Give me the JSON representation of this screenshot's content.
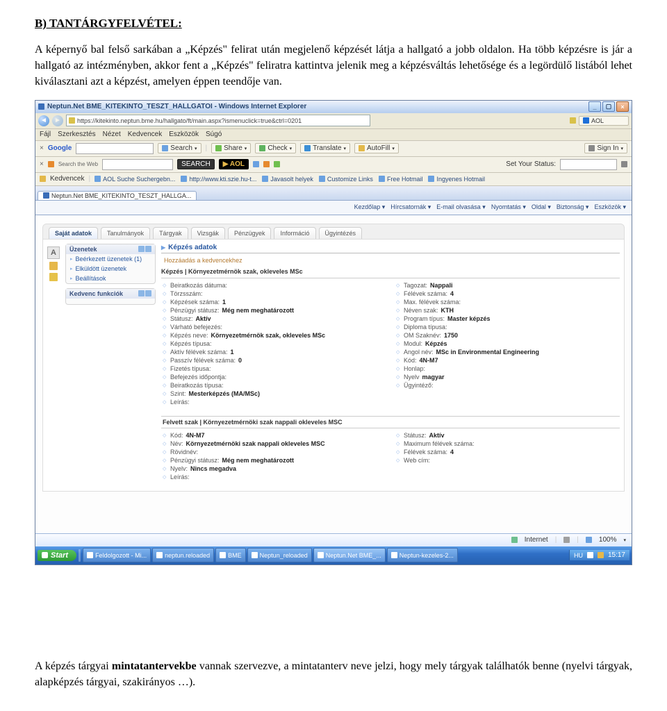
{
  "heading": "B) TANTÁRGYFELVÉTEL:",
  "intro_para": "A képernyő bal felső sarkában a „Képzés\" felirat után megjelenő képzését látja a hallgató a jobb oldalon. Ha több képzésre is jár a hallgató az intézményben, akkor fent a „Képzés\" feliratra kattintva jelenik meg a képzésváltás lehetősége és a legördülő listából lehet kiválasztani azt a képzést, amelyen éppen teendője van.",
  "para3_pre": "A képzés tárgyai ",
  "para3_bold": "mintatantervekbe",
  "para3_post": " vannak szervezve, a mintatanterv neve jelzi, hogy mely tárgyak találhatók benne (nyelvi tárgyak, alapképzés tárgyai, szakirányos …).",
  "window_title": "Neptun.Net BME_KITEKINTO_TESZT_HALLGATOI - Windows Internet Explorer",
  "url": "https://kitekinto.neptun.bme.hu/hallgato/ft/main.aspx?ismenuclick=true&ctrl=0201",
  "ie_menu": [
    "Fájl",
    "Szerkesztés",
    "Nézet",
    "Kedvencek",
    "Eszközök",
    "Súgó"
  ],
  "toolbar_google": "Google",
  "toolbar_search": "Search",
  "toolbar_share": "Share",
  "toolbar_check": "Check",
  "toolbar_translate": "Translate",
  "toolbar_autofill": "AutoFill",
  "toolbar_signin": "Sign In",
  "toolbar_aol_search": "SEARCH",
  "toolbar_set_status": "Set Your Status:",
  "fav_label": "Kedvencek",
  "fav_items": [
    "AOL Suche Suchergebn...",
    "http://www.kti.szie.hu-t...",
    "Javasolt helyek",
    "Customize Links",
    "Free Hotmail",
    "Ingyenes Hotmail"
  ],
  "tab_label": "Neptun.Net BME_KITEKINTO_TESZT_HALLGA...",
  "ie_tb2": [
    "Kezdőlap",
    "Hírcsatornák",
    "E-mail olvasása",
    "Nyomtatás",
    "Oldal",
    "Biztonság",
    "Eszközök"
  ],
  "neptun_tabs": [
    "Saját adatok",
    "Tanulmányok",
    "Tárgyak",
    "Vizsgák",
    "Pénzügyek",
    "Információ",
    "Ügyintézés"
  ],
  "sidebar_box1_title": "Üzenetek",
  "sidebar_box1_items": [
    "Beérkezett üzenetek (1)",
    "Elküldött üzenetek",
    "Beállítások"
  ],
  "sidebar_box2_title": "Kedvenc funkciók",
  "content_header": "Képzés adatok",
  "fav_link": "Hozzáadás a kedvencekhez",
  "kepzes_sub": "Képzés | Környezetmérnök szak, okleveles MSc",
  "left_fields": [
    {
      "lab": "Beiratkozás dátuma:",
      "val": ""
    },
    {
      "lab": "Törzsszám:",
      "val": ""
    },
    {
      "lab": "Képzések száma:",
      "val": "1"
    },
    {
      "lab": "Pénzügyi státusz:",
      "val": "Még nem meghatározott"
    },
    {
      "lab": "Státusz:",
      "val": "Aktív"
    },
    {
      "lab": "Várható befejezés:",
      "val": ""
    },
    {
      "lab": "Képzés neve:",
      "val": "Környezetmérnök szak, okleveles MSc"
    },
    {
      "lab": "Képzés típusa:",
      "val": ""
    },
    {
      "lab": "Aktív félévek száma:",
      "val": "1"
    },
    {
      "lab": "Passzív félévek száma:",
      "val": "0"
    },
    {
      "lab": "Fizetés típusa:",
      "val": ""
    },
    {
      "lab": "Befejezés időpontja:",
      "val": ""
    },
    {
      "lab": "Beiratkozás típusa:",
      "val": ""
    },
    {
      "lab": "Szint:",
      "val": "Mesterképzés (MA/MSc)"
    },
    {
      "lab": "Leírás:",
      "val": ""
    }
  ],
  "right_fields": [
    {
      "lab": "Tagozat:",
      "val": "Nappali"
    },
    {
      "lab": "Félévek száma:",
      "val": "4"
    },
    {
      "lab": "Max. félévek száma:",
      "val": ""
    },
    {
      "lab": "Néven szak:",
      "val": "KTH"
    },
    {
      "lab": "Program típus:",
      "val": "Master képzés"
    },
    {
      "lab": "Diploma típusa:",
      "val": ""
    },
    {
      "lab": "OM Szaknév:",
      "val": "1750"
    },
    {
      "lab": "Modul:",
      "val": "Képzés"
    },
    {
      "lab": "Angol név:",
      "val": "MSc in Environmental Engineering"
    },
    {
      "lab": "Kód:",
      "val": "4N-M7"
    },
    {
      "lab": "Honlap:",
      "val": ""
    },
    {
      "lab": "Nyelv",
      "val": "magyar"
    },
    {
      "lab": "Ügyintéző:",
      "val": ""
    }
  ],
  "section2_title": "Felvett szak | Környezetmérnöki szak nappali okleveles MSC",
  "s2_left": [
    {
      "lab": "Kód:",
      "val": "4N-M7"
    },
    {
      "lab": "Név:",
      "val": "Környezetmérnöki szak nappali okleveles MSC"
    },
    {
      "lab": "Rövidnév:",
      "val": ""
    },
    {
      "lab": "Pénzügyi státusz:",
      "val": "Még nem meghatározott"
    },
    {
      "lab": "Nyelv:",
      "val": "Nincs megadva"
    },
    {
      "lab": "Leírás:",
      "val": ""
    }
  ],
  "s2_right": [
    {
      "lab": "Státusz:",
      "val": "Aktív"
    },
    {
      "lab": "Maximum félévek száma:",
      "val": ""
    },
    {
      "lab": "Félévek száma:",
      "val": "4"
    },
    {
      "lab": "Web cím:",
      "val": ""
    }
  ],
  "status_internet": "Internet",
  "status_zoom": "100%",
  "start_label": "Start",
  "task_items": [
    "Feldolgozott - Mi...",
    "neptun.reloaded",
    "BME",
    "Neptun_reloaded",
    "Neptun.Net BME_...",
    "Neptun-kezeles-2..."
  ],
  "clock": "15:17",
  "lang": "HU"
}
